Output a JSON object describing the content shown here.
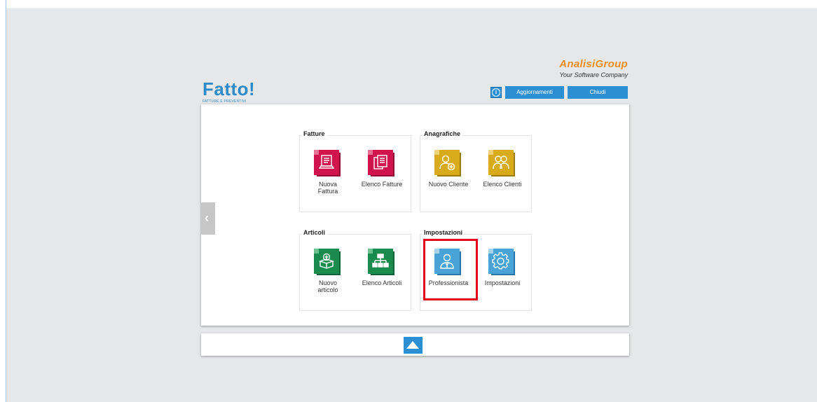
{
  "brand": {
    "title": "Fatto!",
    "subtitle": "FATTURE E PREVENTIVI",
    "company": "AnalisiGroup",
    "company_tagline": "Your Software Company"
  },
  "toolbar": {
    "info_label": "i",
    "aggiornamenti_label": "Aggiornamenti",
    "chiudi_label": "Chiudi"
  },
  "groups": {
    "fatture": {
      "title": "Fatture",
      "tiles": [
        {
          "label": "Nuova Fattura",
          "icon": "invoice-laptop-icon"
        },
        {
          "label": "Elenco Fatture",
          "icon": "documents-list-icon"
        }
      ]
    },
    "anagrafiche": {
      "title": "Anagrafiche",
      "tiles": [
        {
          "label": "Nuovo Cliente",
          "icon": "add-user-icon"
        },
        {
          "label": "Elenco Clienti",
          "icon": "users-icon"
        }
      ]
    },
    "articoli": {
      "title": "Articoli",
      "tiles": [
        {
          "label": "Nuovo articolo",
          "icon": "add-box-icon"
        },
        {
          "label": "Elenco Articoli",
          "icon": "hierarchy-icon"
        }
      ]
    },
    "impostazioni": {
      "title": "Impostazioni",
      "tiles": [
        {
          "label": "Professionista",
          "icon": "professional-icon"
        },
        {
          "label": "Impostazioni",
          "icon": "gear-icon"
        }
      ]
    }
  },
  "colors": {
    "accent": "#2d8fd3",
    "fatture": "#d0154e",
    "anagrafiche": "#d8ab1c",
    "articoli": "#1b8b4d",
    "impostazioni": "#4aa3d6",
    "highlight": "#e3001b",
    "company_orange": "#f28c1e"
  }
}
